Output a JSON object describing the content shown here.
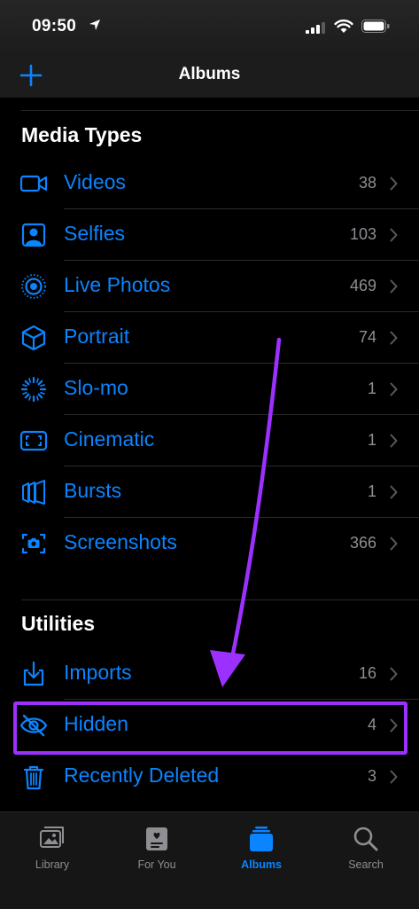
{
  "status_bar": {
    "time": "09:50"
  },
  "nav": {
    "title": "Albums"
  },
  "media_types": {
    "title": "Media Types",
    "items": [
      {
        "label": "Videos",
        "count": "38",
        "icon": "video-icon"
      },
      {
        "label": "Selfies",
        "count": "103",
        "icon": "selfie-icon"
      },
      {
        "label": "Live Photos",
        "count": "469",
        "icon": "live-photo-icon"
      },
      {
        "label": "Portrait",
        "count": "74",
        "icon": "portrait-cube-icon"
      },
      {
        "label": "Slo-mo",
        "count": "1",
        "icon": "slo-mo-icon"
      },
      {
        "label": "Cinematic",
        "count": "1",
        "icon": "cinematic-icon"
      },
      {
        "label": "Bursts",
        "count": "1",
        "icon": "bursts-icon"
      },
      {
        "label": "Screenshots",
        "count": "366",
        "icon": "screenshot-icon"
      }
    ]
  },
  "utilities": {
    "title": "Utilities",
    "items": [
      {
        "label": "Imports",
        "count": "16",
        "icon": "import-icon"
      },
      {
        "label": "Hidden",
        "count": "4",
        "icon": "hidden-eye-icon"
      },
      {
        "label": "Recently Deleted",
        "count": "3",
        "icon": "trash-icon"
      }
    ]
  },
  "tabs": [
    {
      "label": "Library",
      "icon": "library-icon",
      "active": false
    },
    {
      "label": "For You",
      "icon": "for-you-icon",
      "active": false
    },
    {
      "label": "Albums",
      "icon": "albums-icon",
      "active": true
    },
    {
      "label": "Search",
      "icon": "search-icon",
      "active": false
    }
  ],
  "colors": {
    "accent": "#0a84ff",
    "secondary_text": "#8e8e93",
    "annotation": "#9b30ff",
    "background": "#000000"
  }
}
